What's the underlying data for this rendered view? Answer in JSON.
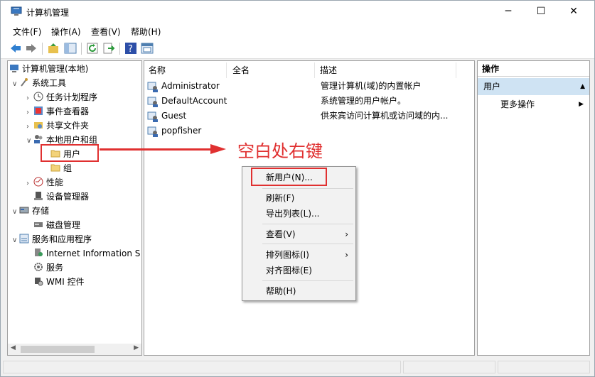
{
  "window": {
    "title": "计算机管理"
  },
  "menu": [
    "文件(F)",
    "操作(A)",
    "查看(V)",
    "帮助(H)"
  ],
  "tree": [
    {
      "label": "计算机管理(本地)",
      "level": 0,
      "expander": "",
      "icon": "computer-management-icon"
    },
    {
      "label": "系统工具",
      "level": 1,
      "expander": "v",
      "icon": "tools-icon"
    },
    {
      "label": "任务计划程序",
      "level": 2,
      "expander": ">",
      "icon": "clock-icon"
    },
    {
      "label": "事件查看器",
      "level": 2,
      "expander": ">",
      "icon": "event-viewer-icon"
    },
    {
      "label": "共享文件夹",
      "level": 2,
      "expander": ">",
      "icon": "shared-folder-icon"
    },
    {
      "label": "本地用户和组",
      "level": 2,
      "expander": "v",
      "icon": "users-group-icon"
    },
    {
      "label": "用户",
      "level": 3,
      "expander": "",
      "icon": "folder-icon"
    },
    {
      "label": "组",
      "level": 3,
      "expander": "",
      "icon": "folder-icon"
    },
    {
      "label": "性能",
      "level": 2,
      "expander": ">",
      "icon": "performance-icon"
    },
    {
      "label": "设备管理器",
      "level": 2,
      "expander": "",
      "icon": "device-manager-icon"
    },
    {
      "label": "存储",
      "level": 1,
      "expander": "v",
      "icon": "storage-icon"
    },
    {
      "label": "磁盘管理",
      "level": 2,
      "expander": "",
      "icon": "disk-icon"
    },
    {
      "label": "服务和应用程序",
      "level": 1,
      "expander": "v",
      "icon": "services-apps-icon"
    },
    {
      "label": "Internet Information S",
      "level": 2,
      "expander": "",
      "icon": "iis-icon"
    },
    {
      "label": "服务",
      "level": 2,
      "expander": "",
      "icon": "services-gear-icon"
    },
    {
      "label": "WMI 控件",
      "level": 2,
      "expander": "",
      "icon": "wmi-icon"
    }
  ],
  "list": {
    "columns": [
      "名称",
      "全名",
      "描述"
    ],
    "rows": [
      {
        "name": "Administrator",
        "fullname": "",
        "desc": "管理计算机(域)的内置帐户"
      },
      {
        "name": "DefaultAccount",
        "fullname": "",
        "desc": "系统管理的用户帐户。"
      },
      {
        "name": "Guest",
        "fullname": "",
        "desc": "供来宾访问计算机或访问域的内..."
      },
      {
        "name": "popfisher",
        "fullname": "",
        "desc": ""
      }
    ]
  },
  "actions": {
    "header": "操作",
    "section": "用户",
    "more": "更多操作"
  },
  "context_menu": [
    {
      "label": "新用户(N)...",
      "submenu": false
    },
    {
      "label": "刷新(F)",
      "submenu": false
    },
    {
      "label": "导出列表(L)...",
      "submenu": false
    },
    {
      "label": "查看(V)",
      "submenu": true
    },
    {
      "label": "排列图标(I)",
      "submenu": true
    },
    {
      "label": "对齐图标(E)",
      "submenu": false
    },
    {
      "label": "帮助(H)",
      "submenu": false
    }
  ],
  "annotation": "空白处右键",
  "colors": {
    "accent": "#e03030",
    "selection": "#cfe3f3"
  }
}
